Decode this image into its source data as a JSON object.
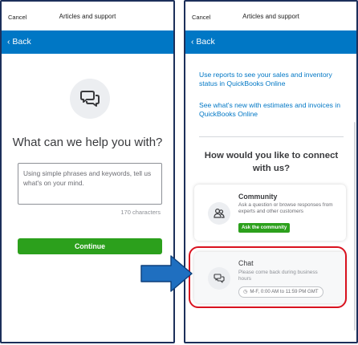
{
  "left_panel": {
    "cancel": "Cancel",
    "title": "Articles and support",
    "back": "‹ Back",
    "icon": "chat-bubbles-icon",
    "heading": "What can we help you with?",
    "placeholder": "Using simple phrases and keywords, tell us what's on your mind.",
    "char_count": "170 characters",
    "continue": "Continue"
  },
  "right_panel": {
    "cancel": "Cancel",
    "title": "Articles and support",
    "back": "‹ Back",
    "articles": [
      "Use reports to see your sales and inventory status in QuickBooks Online",
      "See what's new with estimates and invoices in QuickBooks Online"
    ],
    "connect_heading": "How would you like to connect with us?",
    "community": {
      "icon": "people-icon",
      "title": "Community",
      "description": "Ask a question or browse responses from experts and other customers",
      "button": "Ask the community"
    },
    "chat": {
      "icon": "chat-icon",
      "title": "Chat",
      "description": "Please come back during business hours",
      "hours": "M-F, 0:00 AM to 11:59 PM GMT"
    }
  },
  "colors": {
    "brand_blue": "#0077c5",
    "action_green": "#2ca01c",
    "highlight_red": "#d9121f",
    "arrow_blue": "#1f6fc0"
  }
}
